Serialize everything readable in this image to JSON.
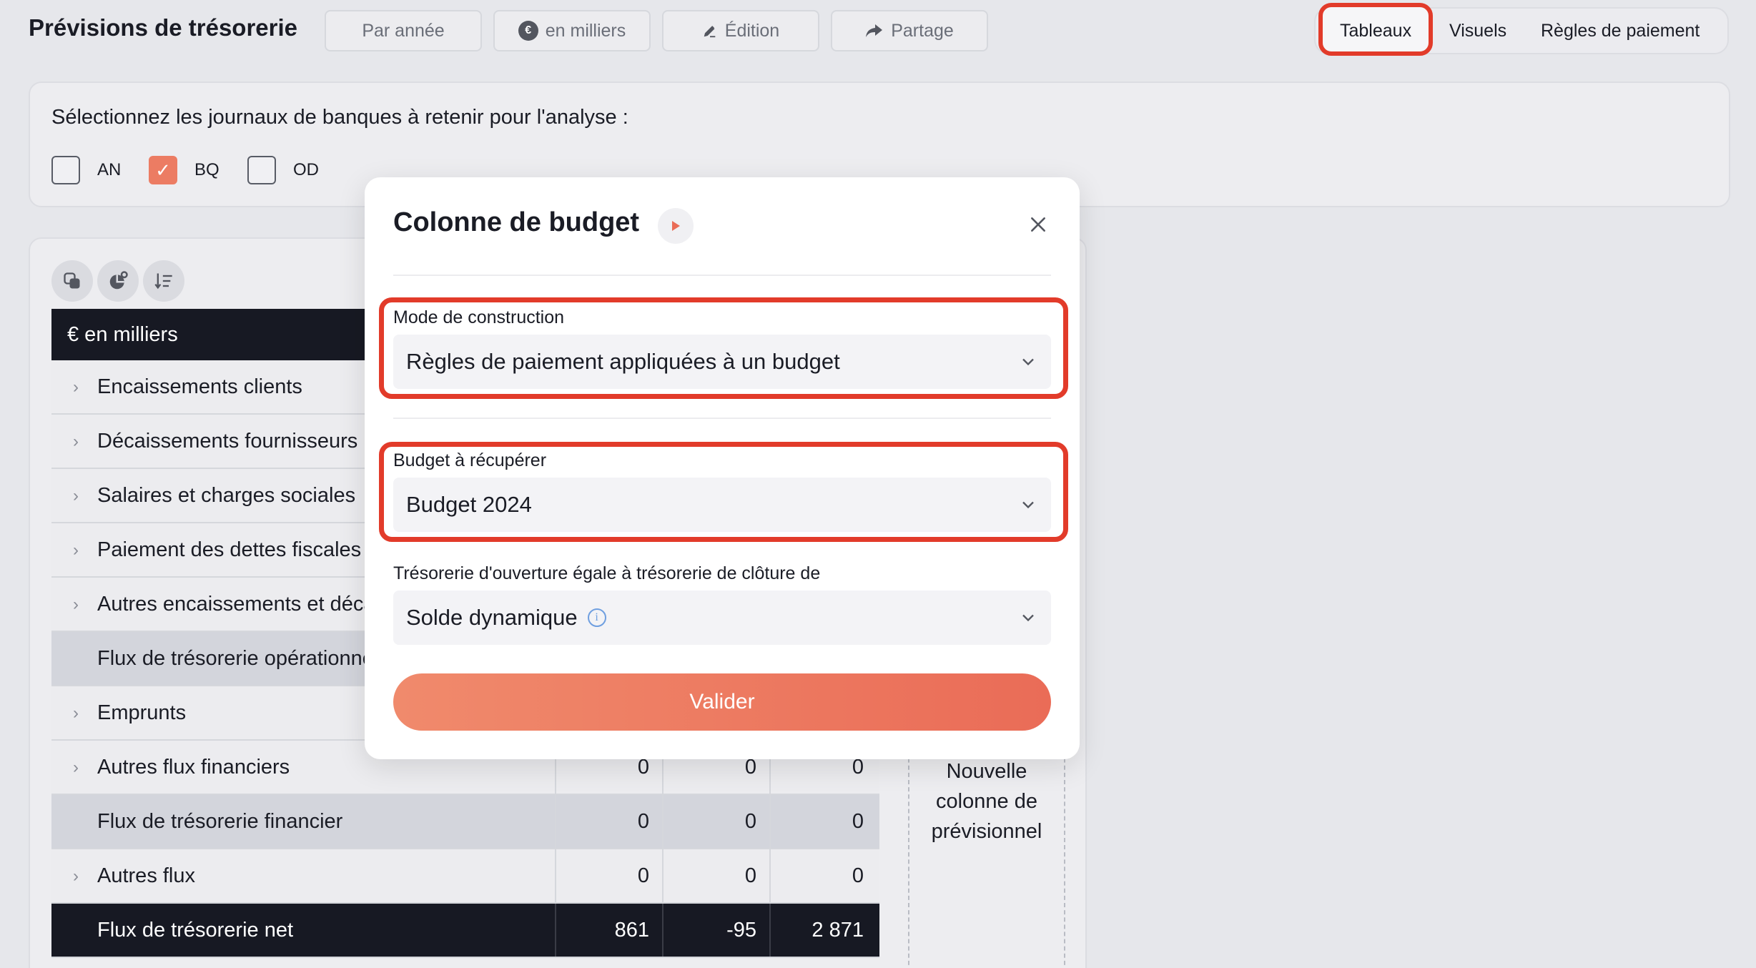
{
  "header": {
    "title": "Prévisions de trésorerie",
    "buttons": {
      "by_year": "Par année",
      "units": "en milliers",
      "units_icon": "€",
      "edit": "Édition",
      "share": "Partage"
    },
    "tabs": [
      "Tableaux",
      "Visuels",
      "Règles de paiement"
    ],
    "active_tab": "Tableaux"
  },
  "journals": {
    "label": "Sélectionnez les journaux de banques à retenir pour l'analyse :",
    "items": [
      {
        "code": "AN",
        "checked": false
      },
      {
        "code": "BQ",
        "checked": true
      },
      {
        "code": "OD",
        "checked": false
      }
    ]
  },
  "table": {
    "header_label": "€ en milliers",
    "rows": [
      {
        "label": "Encaissements clients",
        "expandable": true
      },
      {
        "label": "Décaissements fournisseurs",
        "expandable": true
      },
      {
        "label": "Salaires et charges sociales",
        "expandable": true
      },
      {
        "label": "Paiement des dettes fiscales",
        "expandable": true
      },
      {
        "label": "Autres encaissements et décaissements",
        "expandable": true
      },
      {
        "label": "Flux de trésorerie opérationnel",
        "expandable": false
      },
      {
        "label": "Emprunts",
        "expandable": true
      },
      {
        "label": "Autres flux financiers",
        "expandable": true,
        "values": [
          "0",
          "0",
          "0"
        ]
      },
      {
        "label": "Flux de trésorerie financier",
        "expandable": false,
        "values": [
          "0",
          "0",
          "0"
        ]
      },
      {
        "label": "Autres flux",
        "expandable": true,
        "values": [
          "0",
          "0",
          "0"
        ]
      },
      {
        "label": "Flux de trésorerie net",
        "expandable": false,
        "values": [
          "861",
          "-95",
          "2 871"
        ]
      }
    ],
    "new_column_label": "Nouvelle colonne de prévisionnel"
  },
  "modal": {
    "title": "Colonne de budget",
    "fields": {
      "construction_mode": {
        "label": "Mode de construction",
        "value": "Règles de paiement appliquées à un budget"
      },
      "budget": {
        "label": "Budget à récupérer",
        "value": "Budget 2024"
      },
      "opening_cash": {
        "label": "Trésorerie d'ouverture égale à trésorerie de clôture de",
        "value": "Solde dynamique"
      }
    },
    "submit_label": "Valider"
  },
  "colors": {
    "accent": "#ea6c57",
    "highlight": "#e23b2a",
    "dark_row": "#171923"
  }
}
